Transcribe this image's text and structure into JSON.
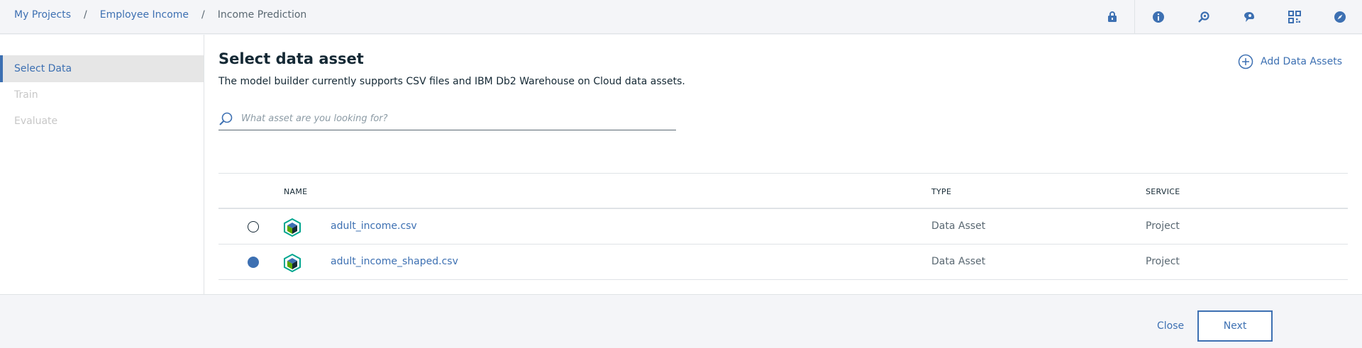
{
  "breadcrumb": {
    "items": [
      "My Projects",
      "Employee Income"
    ],
    "separator": "/",
    "current": "Income Prediction"
  },
  "toolbar": {
    "icons": [
      "lock-icon",
      "info-icon",
      "search-settings-icon",
      "notifications-icon",
      "qr-icon",
      "compass-icon"
    ],
    "color": "#3d70b2"
  },
  "sidebar": {
    "items": [
      {
        "label": "Select Data",
        "state": "active"
      },
      {
        "label": "Train",
        "state": "disabled"
      },
      {
        "label": "Evaluate",
        "state": "disabled"
      }
    ]
  },
  "main": {
    "title": "Select data asset",
    "subtitle": "The model builder currently supports CSV files and IBM Db2 Warehouse on Cloud data assets.",
    "add_assets_label": "Add Data Assets",
    "search_placeholder": "What asset are you looking for?"
  },
  "table": {
    "headers": {
      "name": "NAME",
      "type": "TYPE",
      "service": "SERVICE"
    },
    "rows": [
      {
        "name": "adult_income.csv",
        "type": "Data Asset",
        "service": "Project",
        "selected": false
      },
      {
        "name": "adult_income_shaped.csv",
        "type": "Data Asset",
        "service": "Project",
        "selected": true
      }
    ]
  },
  "footer": {
    "close_label": "Close",
    "next_label": "Next"
  },
  "colors": {
    "accent": "#3d70b2",
    "text": "#152935",
    "muted": "#5a6872",
    "disabled": "#c7c7c7",
    "asset_icon_green": "#5aa700",
    "asset_icon_teal": "#00a68f"
  }
}
